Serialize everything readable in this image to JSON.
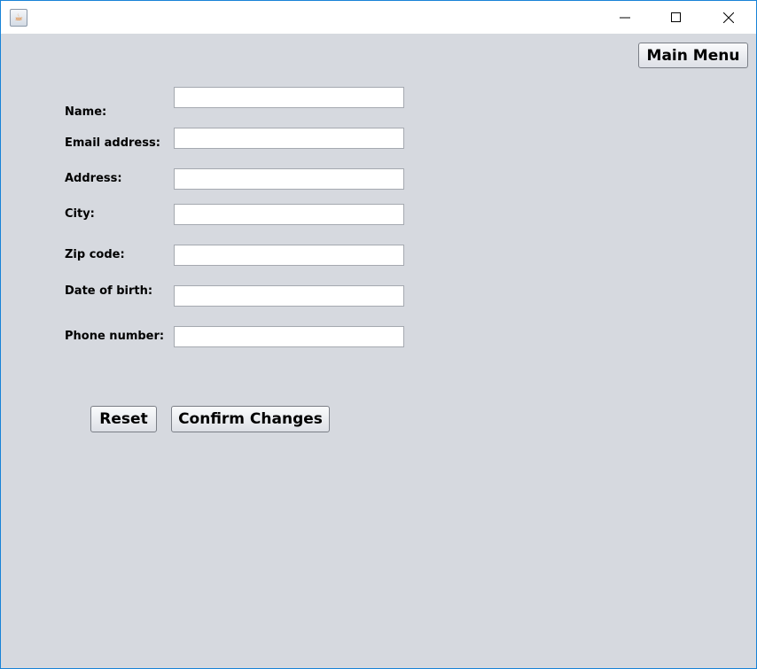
{
  "window": {
    "icon": "java-icon",
    "minimize": "minimize-icon",
    "maximize": "maximize-icon",
    "close": "close-icon"
  },
  "toolbar": {
    "main_menu_label": "Main Menu"
  },
  "form": {
    "fields": [
      {
        "label": "Name:",
        "value": ""
      },
      {
        "label": "Email address:",
        "value": ""
      },
      {
        "label": "Address:",
        "value": ""
      },
      {
        "label": "City:",
        "value": ""
      },
      {
        "label": "Zip code:",
        "value": ""
      },
      {
        "label": "Date of birth:",
        "value": ""
      },
      {
        "label": "Phone number:",
        "value": ""
      }
    ],
    "reset_label": "Reset",
    "confirm_label": "Confirm Changes"
  }
}
